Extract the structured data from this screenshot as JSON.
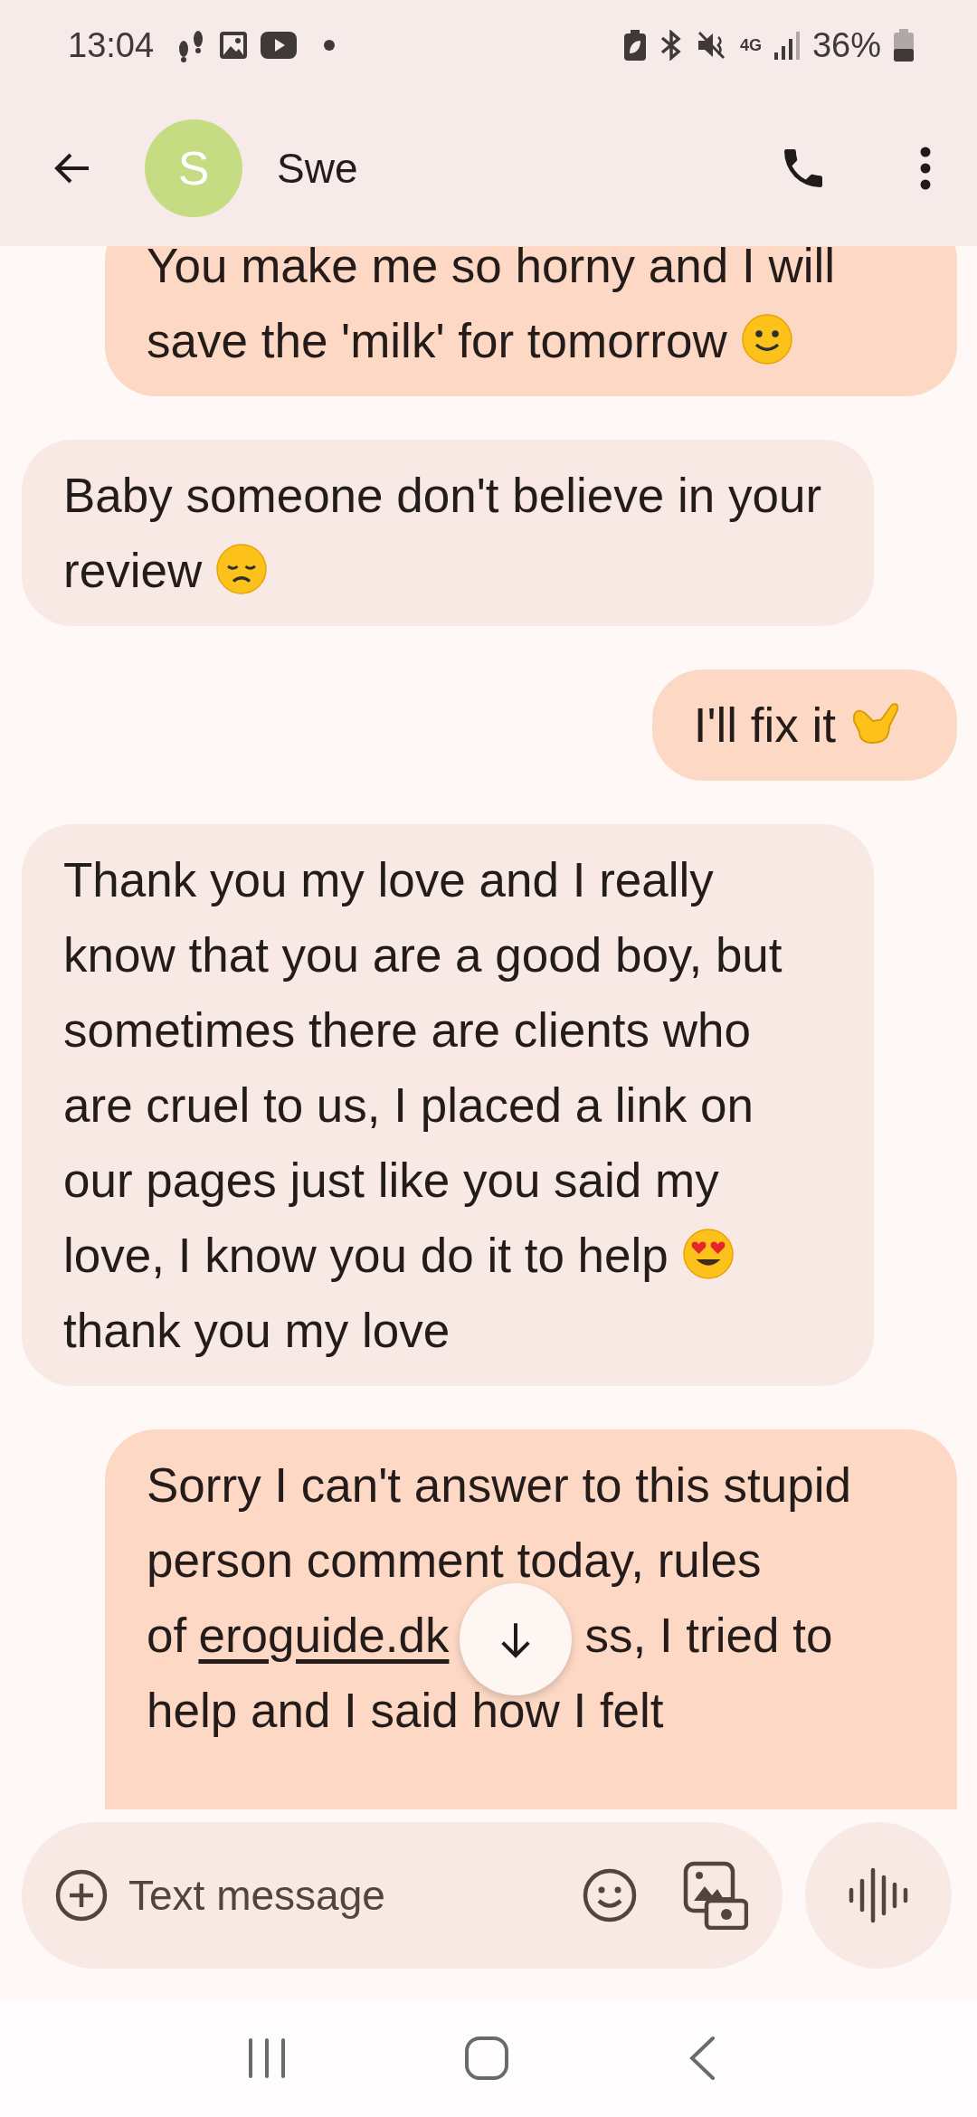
{
  "status_bar": {
    "time": "13:04",
    "battery": "36%",
    "network": "4G"
  },
  "header": {
    "avatar_letter": "S",
    "contact": "Swe"
  },
  "messages": [
    {
      "sent": true,
      "segments": [
        {
          "kind": "text",
          "text": "You make me so horny and I will save the 'milk' for tomorrow"
        },
        {
          "kind": "smile"
        }
      ]
    },
    {
      "sent": false,
      "segments": [
        {
          "kind": "text",
          "text": "Baby someone don't believe in your review"
        },
        {
          "kind": "sad"
        }
      ]
    },
    {
      "sent": true,
      "segments": [
        {
          "kind": "text",
          "text": "I'll fix it"
        },
        {
          "kind": "shaka"
        }
      ]
    },
    {
      "sent": false,
      "segments": [
        {
          "kind": "text",
          "text": "Thank you my love and I really know that you are a good boy, but sometimes there are clients who are cruel to us, I placed a link on our pages just like you said my love, I know you do it to help"
        },
        {
          "kind": "hearteyes"
        },
        {
          "kind": "text",
          "text": "thank you my love"
        }
      ]
    },
    {
      "sent": true,
      "segments": [
        {
          "kind": "text",
          "text": "Sorry I can't answer to this stupid person comment today, rules of"
        },
        {
          "kind": "link",
          "text": "eroguide.dk"
        },
        {
          "kind": "text",
          "text": "ss, I tried to help and I said how I felt"
        }
      ]
    }
  ],
  "composer": {
    "placeholder": "Text message"
  }
}
